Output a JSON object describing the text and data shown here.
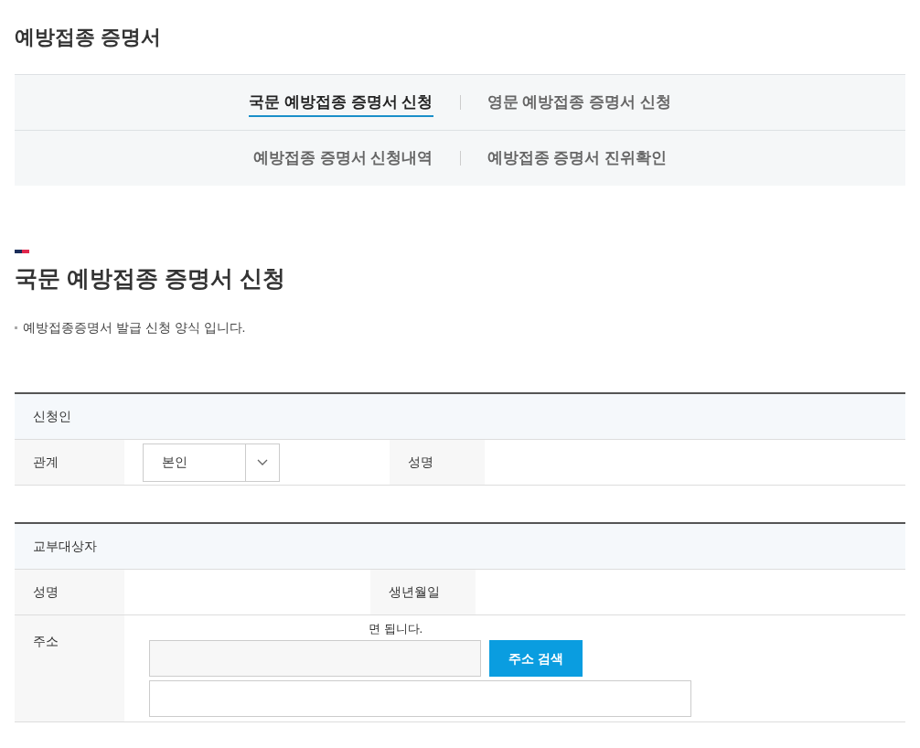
{
  "page_title": "예방접종 증명서",
  "tabs": [
    {
      "label": "국문 예방접종 증명서 신청",
      "selected": true
    },
    {
      "label": "영문 예방접종 증명서 신청",
      "selected": false
    },
    {
      "label": "예방접종 증명서 신청내역",
      "selected": false
    },
    {
      "label": "예방접종 증명서 진위확인",
      "selected": false
    }
  ],
  "section": {
    "title": "국문 예방접종 증명서 신청",
    "note": "예방접종증명서 발급 신청 양식 입니다."
  },
  "applicant": {
    "header": "신청인",
    "relation_label": "관계",
    "relation_value": "본인",
    "name_label": "성명"
  },
  "recipient": {
    "header": "교부대상자",
    "name_label": "성명",
    "birth_label": "생년월일",
    "address_label": "주소",
    "address_hint": "면 됩니다.",
    "search_button": "주소 검색"
  }
}
